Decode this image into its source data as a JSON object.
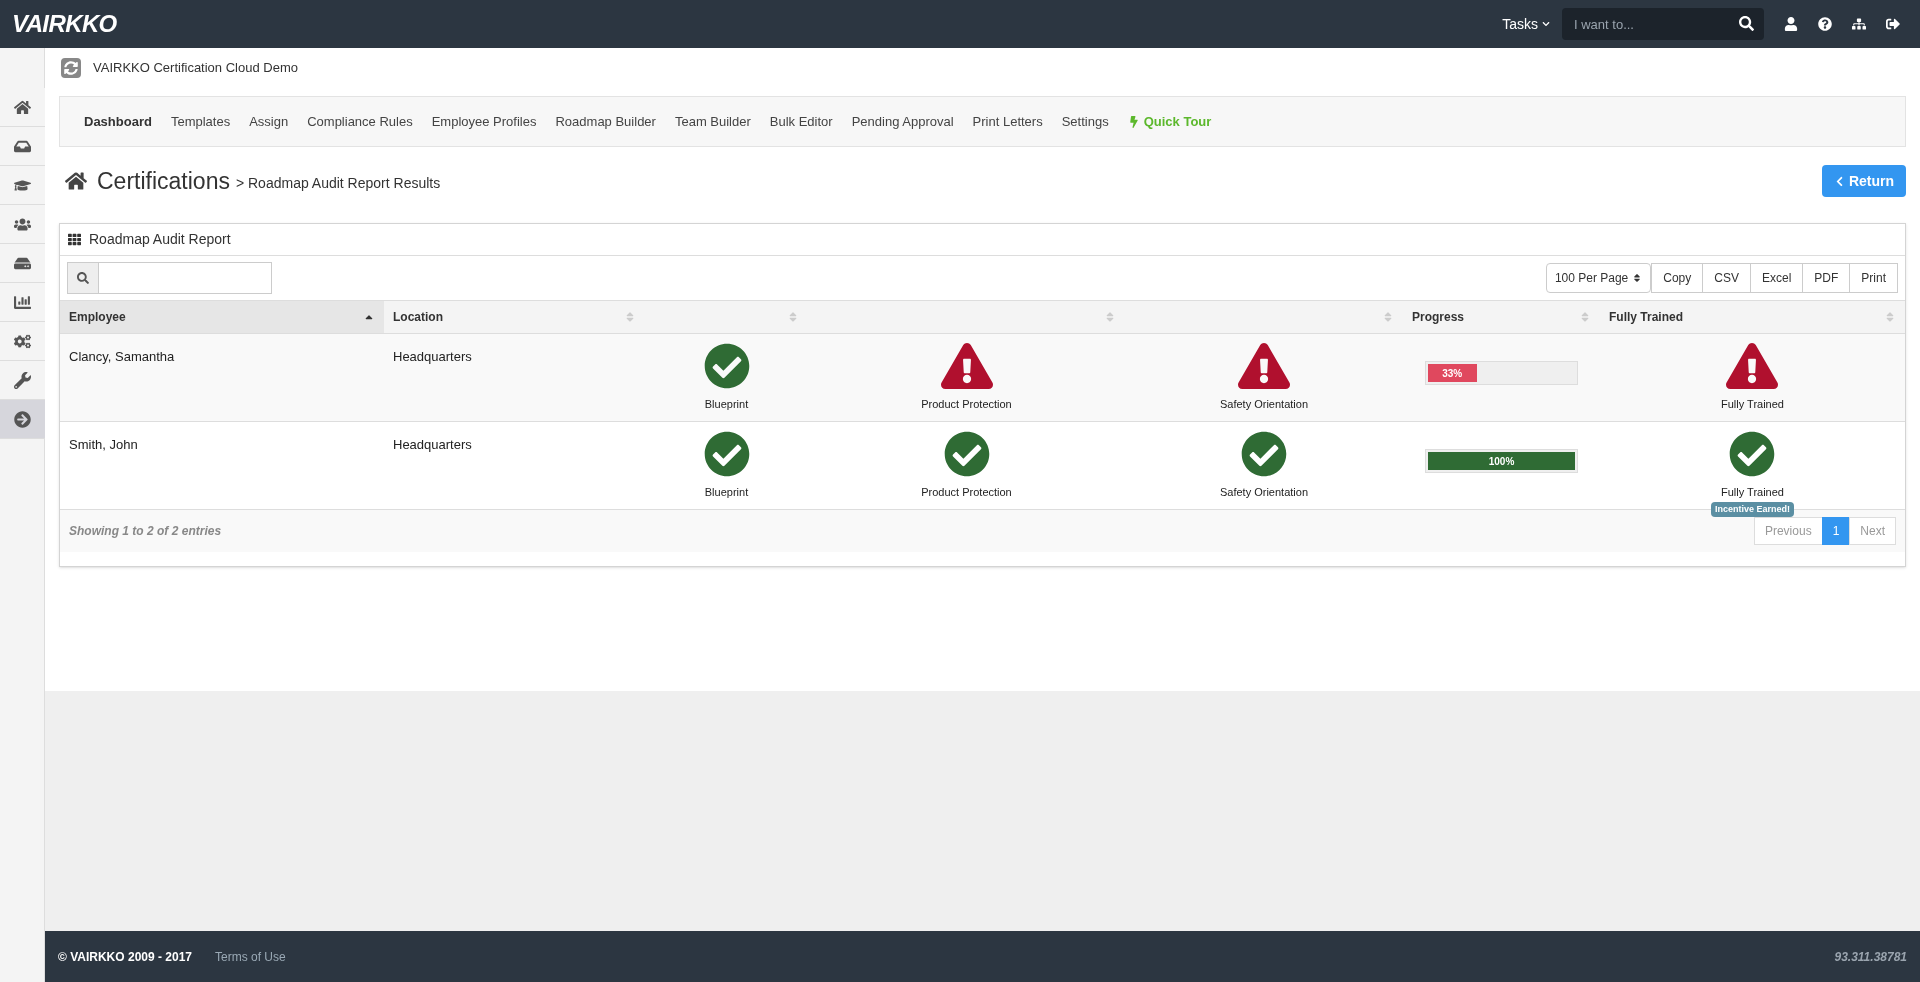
{
  "topbar": {
    "brand": "VAIRKKO",
    "tasks_label": "Tasks",
    "search": {
      "placeholder": "I want to..."
    }
  },
  "sidebar": {
    "items": [
      {
        "selected": false
      },
      {
        "selected": false
      },
      {
        "selected": false
      },
      {
        "selected": false
      },
      {
        "selected": false
      },
      {
        "selected": false
      },
      {
        "selected": false
      },
      {
        "selected": false
      },
      {
        "selected": true
      }
    ]
  },
  "org_name": "VAIRKKO Certification Cloud Demo",
  "nav": [
    {
      "label": "Dashboard",
      "selected": true,
      "kind": "link"
    },
    {
      "label": "Templates",
      "selected": false,
      "kind": "link"
    },
    {
      "label": "Assign",
      "selected": false,
      "kind": "link"
    },
    {
      "label": "Compliance Rules",
      "selected": false,
      "kind": "link"
    },
    {
      "label": "Employee Profiles",
      "selected": false,
      "kind": "link"
    },
    {
      "label": "Roadmap Builder",
      "selected": false,
      "kind": "link"
    },
    {
      "label": "Team Builder",
      "selected": false,
      "kind": "link"
    },
    {
      "label": "Bulk Editor",
      "selected": false,
      "kind": "link"
    },
    {
      "label": "Pending Approval",
      "selected": false,
      "kind": "link"
    },
    {
      "label": "Print Letters",
      "selected": false,
      "kind": "link"
    },
    {
      "label": "Settings",
      "selected": false,
      "kind": "link"
    },
    {
      "label": "Quick Tour",
      "selected": false,
      "kind": "tour"
    }
  ],
  "page_title": "Certifications",
  "breadcrumb": "> Roadmap Audit Report Results",
  "return_button": "Return",
  "panel": {
    "title": "Roadmap Audit Report",
    "page_size": "100 Per Page",
    "export_buttons": [
      "Copy",
      "CSV",
      "Excel",
      "PDF",
      "Print"
    ],
    "columns": [
      {
        "label": "Employee",
        "sorted": true
      },
      {
        "label": "Location",
        "sorted": false
      },
      {
        "sorted": false
      },
      {
        "sorted": false
      },
      {
        "sorted": false
      },
      {
        "label": "Progress",
        "sorted": false
      },
      {
        "label": "Fully Trained",
        "sorted": false
      }
    ],
    "rows": [
      {
        "employee": "Clancy, Samantha",
        "location": "Headquarters",
        "certs": [
          {
            "label": "Blueprint",
            "passed": true
          },
          {
            "label": "Product Protection",
            "passed": false
          },
          {
            "label": "Safety Orientation",
            "passed": false
          }
        ],
        "progress": {
          "level": 0.33,
          "reading": "33%"
        },
        "fully_trained": {
          "label": "Fully Trained",
          "passed": false
        }
      },
      {
        "employee": "Smith, John",
        "location": "Headquarters",
        "certs": [
          {
            "label": "Blueprint",
            "passed": true
          },
          {
            "label": "Product Protection",
            "passed": true
          },
          {
            "label": "Safety Orientation",
            "passed": true
          }
        ],
        "progress": {
          "level": 1,
          "reading": "100%"
        },
        "fully_trained": {
          "label": "Fully Trained",
          "passed": true,
          "badge": "Incentive Earned!"
        }
      }
    ],
    "info": "Showing **1** to **2** of **2** entries",
    "pagination": {
      "previous": "Previous",
      "pages": [
        {
          "label": "1",
          "selected": true
        }
      ],
      "next": "Next"
    }
  },
  "footer": {
    "copyright": "© VAIRKKO 2009 - 2017",
    "terms": "Terms of Use",
    "version": "93.311.38781"
  }
}
